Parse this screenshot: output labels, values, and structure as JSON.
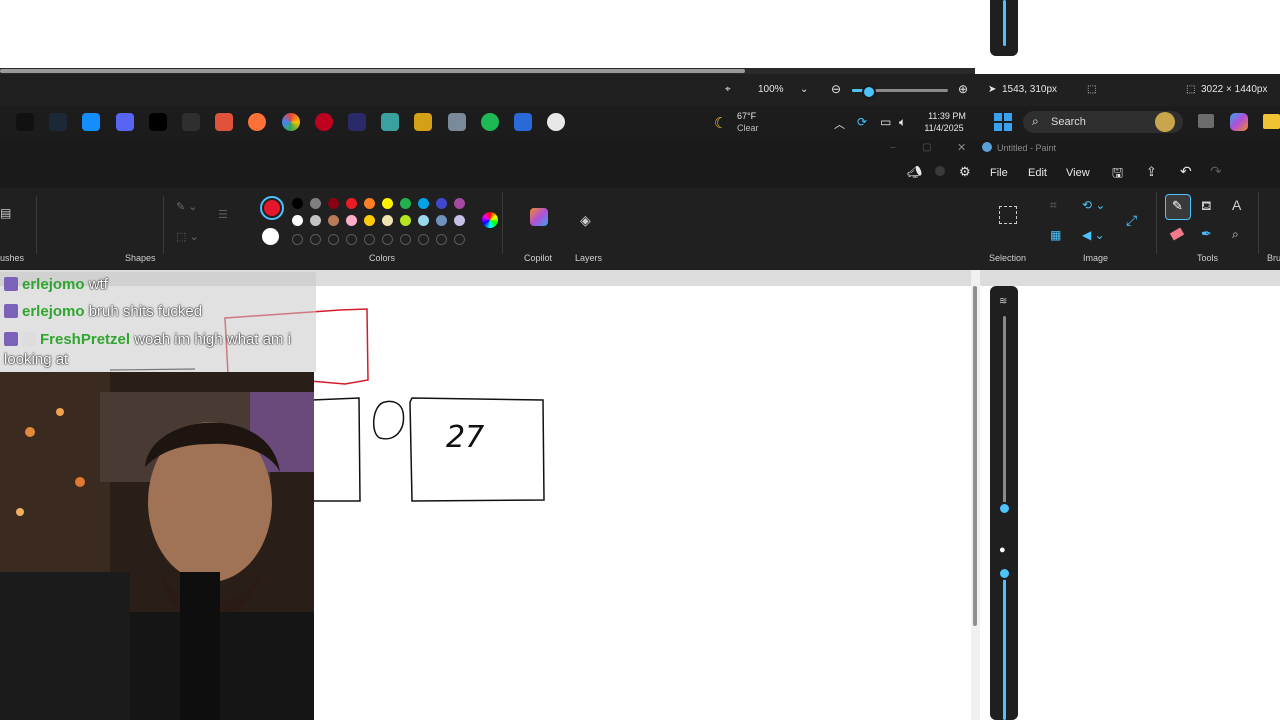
{
  "statusbar": {
    "zoom_value": "100%",
    "zoom_level": 0.15,
    "cursor_position": "1543, 310px",
    "canvas_size": "3022 × 1440px"
  },
  "taskbar": {
    "weather_temp": "67°F",
    "weather_desc": "Clear",
    "time": "11:39 PM",
    "date": "11/4/2025",
    "search_placeholder": "Search",
    "apps": [
      "epic-games-icon",
      "steam-icon",
      "battlenet-icon",
      "discord-icon",
      "x-icon",
      "obs-icon",
      "app-icon",
      "firefox-icon",
      "chrome-icon",
      "opera-icon",
      "4k-icon",
      "paint-palette-icon",
      "photos-icon",
      "camera-icon",
      "spotify-icon",
      "ccleaner-icon",
      "media-player-icon"
    ]
  },
  "paint": {
    "title": "Untitled - Paint",
    "menu": {
      "file": "File",
      "edit": "Edit",
      "view": "View"
    },
    "groups": {
      "brushes": "ushes",
      "shapes": "Shapes",
      "colors": "Colors",
      "copilot": "Copilot",
      "layers": "Layers",
      "selection": "Selection",
      "image": "Image",
      "tools": "Tools",
      "brushes_right": "Bru"
    },
    "primary_color": "#e3182b",
    "secondary_color": "#ffffff",
    "palette_row1": [
      "#000000",
      "#7f7f7f",
      "#880015",
      "#ed1c24",
      "#ff7f27",
      "#fff200",
      "#22b14c",
      "#00a2e8",
      "#3f48cc",
      "#a349a4"
    ],
    "palette_row2": [
      "#ffffff",
      "#c3c3c3",
      "#b97a57",
      "#ffaec9",
      "#ffc90e",
      "#efe4b0",
      "#b5e61d",
      "#99d9ea",
      "#7092be",
      "#c8bfe7"
    ],
    "canvas_text": "27"
  },
  "chat": [
    {
      "user": "erlejomo",
      "msg": "wtf"
    },
    {
      "user": "erlejomo",
      "msg": "bruh shits fucked"
    },
    {
      "user": "FreshPretzel",
      "msg": "woah im high what am i looking at"
    }
  ]
}
